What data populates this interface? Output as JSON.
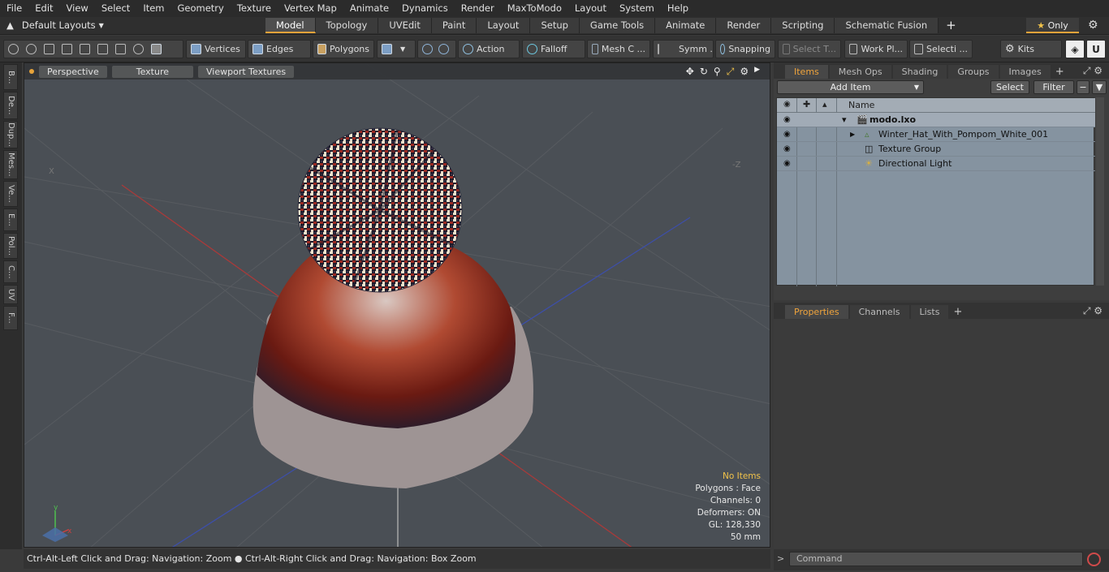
{
  "menu": [
    "File",
    "Edit",
    "View",
    "Select",
    "Item",
    "Geometry",
    "Texture",
    "Vertex Map",
    "Animate",
    "Dynamics",
    "Render",
    "MaxToModo",
    "Layout",
    "System",
    "Help"
  ],
  "layouts_label": "Default Layouts",
  "tabs": [
    {
      "label": "Model",
      "active": true
    },
    {
      "label": "Topology"
    },
    {
      "label": "UVEdit"
    },
    {
      "label": "Paint"
    },
    {
      "label": "Layout"
    },
    {
      "label": "Setup"
    },
    {
      "label": "Game Tools"
    },
    {
      "label": "Animate"
    },
    {
      "label": "Render"
    },
    {
      "label": "Scripting"
    },
    {
      "label": "Schematic Fusion"
    }
  ],
  "tab_add": "+",
  "only_label": "Only",
  "toolbar": {
    "vertices": "Vertices",
    "edges": "Edges",
    "polygons": "Polygons",
    "action": "Action",
    "falloff": "Falloff",
    "mesh": "Mesh C ...",
    "symm": "Symm ...",
    "snapping": "Snapping",
    "select_t": "Select T...",
    "work_pl": "Work Pl...",
    "selecti": "Selecti ...",
    "kits": "Kits"
  },
  "left_tabs": [
    "B...",
    "De...",
    "Dup...",
    "Mes...",
    "Ve...",
    "E...",
    "Pol...",
    "C...",
    "UV",
    "F..."
  ],
  "viewport": {
    "perspective": "Perspective",
    "texture": "Texture",
    "viewport_textures": "Viewport Textures",
    "axis_x": "X",
    "axis_z": "-Z",
    "stats": {
      "no_items": "No Items",
      "polygons": "Polygons : Face",
      "channels": "Channels: 0",
      "deformers": "Deformers: ON",
      "gl": "GL: 128,330",
      "size": "50 mm"
    }
  },
  "status_text": "Ctrl-Alt-Left Click and Drag: Navigation: Zoom ● Ctrl-Alt-Right Click and Drag: Navigation: Box Zoom",
  "items_panel": {
    "tabs": [
      "Items",
      "Mesh Ops",
      "Shading",
      "Groups",
      "Images"
    ],
    "add_item": "Add Item",
    "select": "Select",
    "filter": "Filter",
    "name_col": "Name",
    "rows": [
      {
        "label": "modo.lxo",
        "icon": "scene-icon"
      },
      {
        "label": "Winter_Hat_With_Pompom_White_001",
        "icon": "mesh-icon"
      },
      {
        "label": "Texture Group",
        "icon": "texture-group-icon"
      },
      {
        "label": "Directional Light",
        "icon": "light-icon"
      }
    ]
  },
  "props_panel": {
    "tabs": [
      "Properties",
      "Channels",
      "Lists"
    ]
  },
  "command_placeholder": "Command",
  "colors": {
    "accent": "#e7a33a",
    "tree_bg": "#8593a0",
    "viewport_bg": "#4a4f55"
  }
}
